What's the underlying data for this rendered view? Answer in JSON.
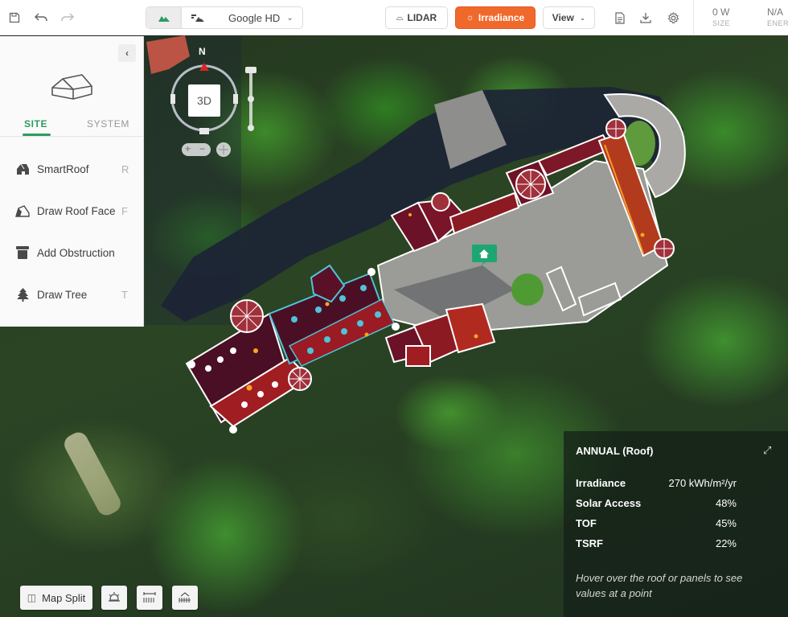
{
  "toolbar": {
    "save_icon": "save-icon",
    "undo_icon": "undo-icon",
    "redo_icon": "redo-icon",
    "imagery": {
      "mode_3d_icon": "terrain-icon",
      "mode_2d_icon": "flat-map-icon",
      "source_label": "Google HD",
      "source_chevron": "⌄"
    },
    "lidar_label": "LIDAR",
    "irradiance_label": "Irradiance",
    "view_label": "View",
    "view_chevron": "⌄",
    "report_icon": "document-icon",
    "download_icon": "download-icon",
    "settings_icon": "gear-icon",
    "stats": [
      {
        "value": "0 W",
        "label": "SIZE"
      },
      {
        "value": "N/A",
        "label": "ENER"
      }
    ]
  },
  "sidebar": {
    "collapse_glyph": "‹",
    "tabs": [
      {
        "label": "SITE",
        "active": true
      },
      {
        "label": "SYSTEM",
        "active": false
      }
    ],
    "tools": [
      {
        "label": "SmartRoof",
        "key": "R",
        "icon": "smartroof-icon"
      },
      {
        "label": "Draw Roof Face",
        "key": "F",
        "icon": "roof-face-icon"
      },
      {
        "label": "Add Obstruction",
        "key": "",
        "icon": "obstruction-icon"
      },
      {
        "label": "Draw Tree",
        "key": "T",
        "icon": "tree-icon"
      }
    ]
  },
  "map_controls": {
    "north_label": "N",
    "mode_3d_label": "3D",
    "zoom_in_glyph": "+",
    "zoom_out_glyph": "−"
  },
  "info_panel": {
    "title": "ANNUAL (Roof)",
    "rows": [
      {
        "label": "Irradiance",
        "value": "270 kWh/m²/yr"
      },
      {
        "label": "Solar Access",
        "value": "48%"
      },
      {
        "label": "TOF",
        "value": "45%"
      },
      {
        "label": "TSRF",
        "value": "22%"
      }
    ],
    "hint": "Hover over the roof or panels to see values at a point"
  },
  "bottom_bar": {
    "map_split_label": "Map Split",
    "buttons": [
      "shading-icon",
      "measure-icon",
      "setback-icon"
    ]
  },
  "colors": {
    "accent_green": "#2e9a62",
    "irradiance_orange": "#f0692c",
    "roof_low": "#4a0f24",
    "roof_mid": "#8c1a22",
    "roof_high": "#c64a1e",
    "selection_cyan": "#4fc3d9",
    "marker_green": "#1ea672"
  }
}
